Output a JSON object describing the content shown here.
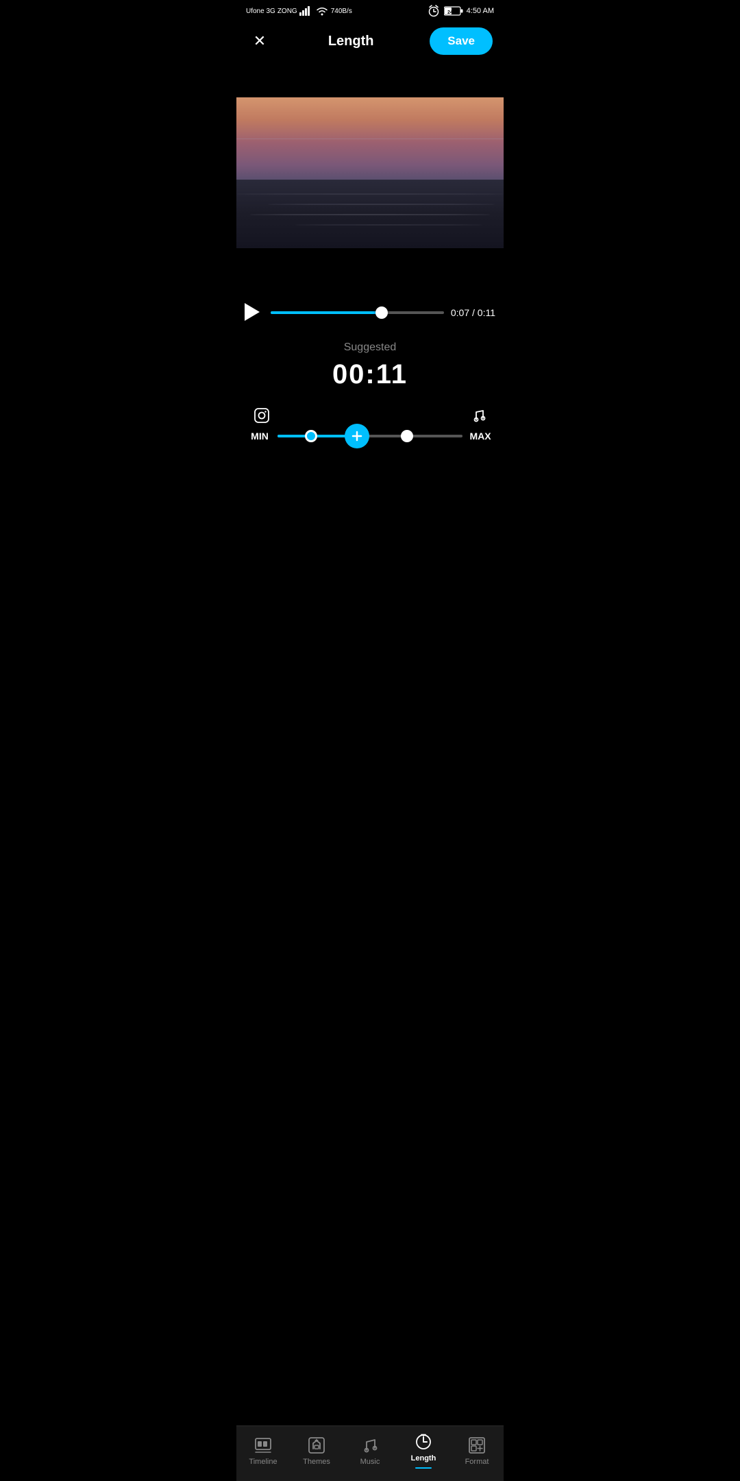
{
  "statusBar": {
    "carrier": "Ufone 3G",
    "carrier2": "ZONG",
    "speed": "740B/s",
    "time": "4:50 AM",
    "battery": "24"
  },
  "header": {
    "title": "Length",
    "closeLabel": "×",
    "saveLabel": "Save"
  },
  "playback": {
    "progress": "64%",
    "currentTime": "0:07",
    "totalTime": "0:11",
    "timeLabel": "0:07 / 0:11"
  },
  "suggested": {
    "label": "Suggested",
    "time": "00:11"
  },
  "slider": {
    "minLabel": "MIN",
    "maxLabel": "MAX"
  },
  "bottomNav": {
    "items": [
      {
        "id": "timeline",
        "label": "Timeline",
        "active": false
      },
      {
        "id": "themes",
        "label": "Themes",
        "active": false
      },
      {
        "id": "music",
        "label": "Music",
        "active": false
      },
      {
        "id": "length",
        "label": "Length",
        "active": true
      },
      {
        "id": "format",
        "label": "Format",
        "active": false
      }
    ]
  }
}
